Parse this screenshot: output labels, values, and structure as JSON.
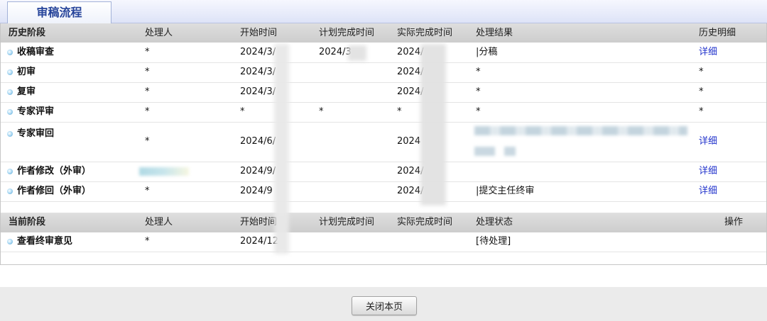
{
  "tabs": [
    {
      "label": "审稿流程"
    }
  ],
  "history": {
    "headers": {
      "stage": "历史阶段",
      "handler": "处理人",
      "start": "开始时间",
      "planned": "计划完成时间",
      "actual": "实际完成时间",
      "result": "处理结果",
      "detail": "历史明细"
    },
    "rows": [
      {
        "stage": "收稿审查",
        "handler": "*",
        "start": "2024/3/",
        "planned": "2024/3",
        "actual": "2024/",
        "result": "|分稿",
        "detail": "详细"
      },
      {
        "stage": "初审",
        "handler": "*",
        "start": "2024/3/",
        "planned": "",
        "actual": "2024/",
        "result": "*",
        "detail": "*"
      },
      {
        "stage": "复审",
        "handler": "*",
        "start": "2024/3/",
        "planned": "",
        "actual": "2024/",
        "result": "*",
        "detail": "*"
      },
      {
        "stage": "专家评审",
        "handler": "*",
        "start": "*",
        "planned": "*",
        "actual": "*",
        "result": "*",
        "detail": "*"
      },
      {
        "stage": "专家审回",
        "handler": "*",
        "start": "2024/6/",
        "planned": "",
        "actual": "2024",
        "result": "",
        "detail": "详细"
      },
      {
        "stage": "作者修改（外审）",
        "handler": "",
        "start": "2024/9/",
        "planned": "",
        "actual": "2024/",
        "result": "",
        "detail": "详细"
      },
      {
        "stage": "作者修回（外审）",
        "handler": "*",
        "start": "2024/9",
        "planned": "",
        "actual": "2024/",
        "result": "|提交主任终审",
        "detail": "详细"
      }
    ]
  },
  "current": {
    "headers": {
      "stage": "当前阶段",
      "handler": "处理人",
      "start": "开始时间",
      "planned": "计划完成时间",
      "actual": "实际完成时间",
      "status": "处理状态",
      "action": "操作"
    },
    "rows": [
      {
        "stage": "查看终审意见",
        "handler": "*",
        "start": "2024/12",
        "planned": "",
        "actual": "",
        "status": "[待处理]",
        "action": ""
      }
    ]
  },
  "footer": {
    "close_label": "关闭本页"
  },
  "icons": {
    "stage_bullet": "bullet-icon"
  },
  "colors": {
    "link": "#2233cc",
    "tab_text": "#26449a",
    "tab_border": "#a3b2d8",
    "header_bg": "#cdcdcd",
    "bullet": "#4fa3d9",
    "footer_bg": "#ebebeb"
  }
}
